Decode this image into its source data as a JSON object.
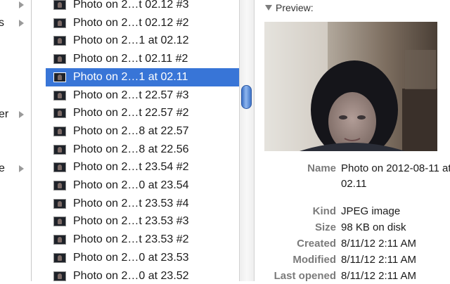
{
  "sidebar": {
    "items": [
      {
        "fragment": "",
        "has_arrow": true
      },
      {
        "fragment": "s",
        "has_arrow": true
      },
      {
        "fragment": "er",
        "has_arrow": true
      },
      {
        "fragment": "e",
        "has_arrow": true
      }
    ]
  },
  "files": {
    "rows": [
      {
        "name": "Photo on 2…t 02.12 #3",
        "selected": false
      },
      {
        "name": "Photo on 2…t 02.12 #2",
        "selected": false
      },
      {
        "name": "Photo on 2…1 at 02.12",
        "selected": false
      },
      {
        "name": "Photo on 2…t 02.11 #2",
        "selected": false
      },
      {
        "name": "Photo on 2…1 at 02.11",
        "selected": true
      },
      {
        "name": "Photo on 2…t 22.57 #3",
        "selected": false
      },
      {
        "name": "Photo on 2…t 22.57 #2",
        "selected": false
      },
      {
        "name": "Photo on 2…8 at 22.57",
        "selected": false
      },
      {
        "name": "Photo on 2…8 at 22.56",
        "selected": false
      },
      {
        "name": "Photo on 2…t 23.54 #2",
        "selected": false
      },
      {
        "name": "Photo on 2…0 at 23.54",
        "selected": false
      },
      {
        "name": "Photo on 2…t 23.53 #4",
        "selected": false
      },
      {
        "name": "Photo on 2…t 23.53 #3",
        "selected": false
      },
      {
        "name": "Photo on 2…t 23.53 #2",
        "selected": false
      },
      {
        "name": "Photo on 2…0 at 23.53",
        "selected": false
      },
      {
        "name": "Photo on 2…0 at 23.52",
        "selected": false
      }
    ]
  },
  "preview": {
    "heading": "Preview:",
    "info": [
      {
        "label": "Name",
        "value": "Photo on 2012-08-11 at 02.11"
      },
      {
        "label": "Kind",
        "value": "JPEG image"
      },
      {
        "label": "Size",
        "value": "98 KB on disk"
      },
      {
        "label": "Created",
        "value": "8/11/12 2:11 AM"
      },
      {
        "label": "Modified",
        "value": "8/11/12 2:11 AM"
      },
      {
        "label": "Last opened",
        "value": "8/11/12 2:11 AM"
      }
    ]
  },
  "colors": {
    "selection": "#3875d7",
    "label_gray": "#7b7b7b",
    "scroll_thumb": "#3a6fc6"
  }
}
